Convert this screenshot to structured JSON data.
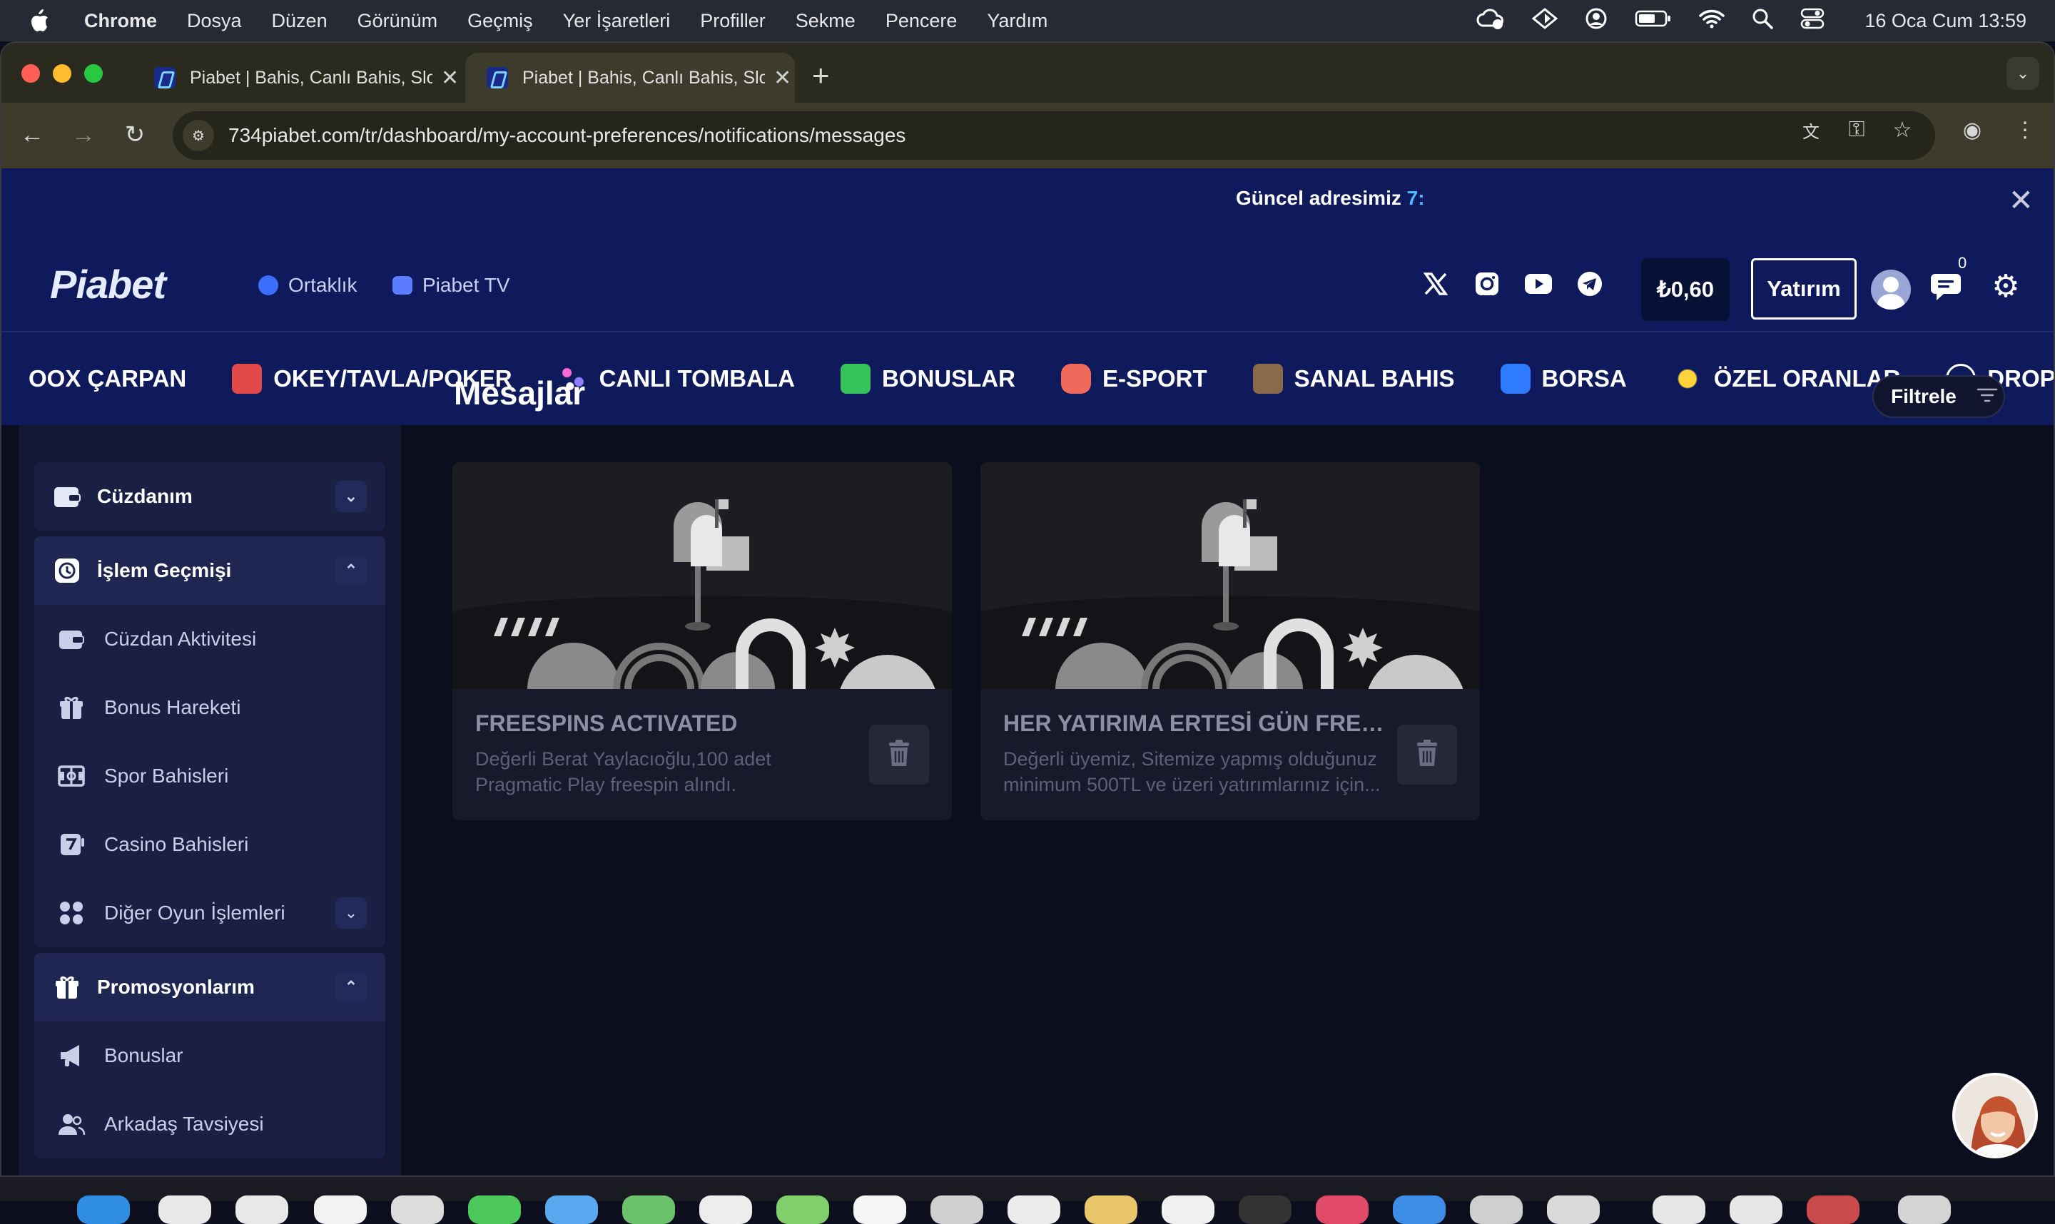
{
  "menubar": {
    "app": "Chrome",
    "items": [
      "Dosya",
      "Düzen",
      "Görünüm",
      "Geçmiş",
      "Yer İşaretleri",
      "Profiller",
      "Sekme",
      "Pencere",
      "Yardım"
    ],
    "clock": "16 Oca Cum  13:59"
  },
  "browser": {
    "tabs": [
      {
        "title": "Piabet | Bahis, Canlı Bahis, Slot"
      },
      {
        "title": "Piabet | Bahis, Canlı Bahis, Slot"
      }
    ],
    "url": "734piabet.com/tr/dashboard/my-account-preferences/notifications/messages"
  },
  "site": {
    "announcement": {
      "text": "Güncel adresimiz ",
      "highlight": "7:"
    },
    "logo": "Piabet",
    "header_links": [
      "Ortaklık",
      "Piabet TV"
    ],
    "balance": "₺0,60",
    "deposit_label": "Yatırım",
    "message_count": "0",
    "categories": [
      "OOX ÇARPAN",
      "OKEY/TAVLA/POKER",
      "CANLI TOMBALA",
      "BONUSLAR",
      "E-SPORT",
      "SANAL BAHIS",
      "BORSA",
      "ÖZEL ORANLAR",
      "DROPS & WINS"
    ]
  },
  "sidebar": {
    "wallet": {
      "label": "Cüzdanım"
    },
    "history": {
      "label": "İşlem Geçmişi",
      "items": [
        "Cüzdan Aktivitesi",
        "Bonus Hareketi",
        "Spor Bahisleri",
        "Casino Bahisleri",
        "Diğer Oyun İşlemleri"
      ]
    },
    "promotions": {
      "label": "Promosyonlarım",
      "items": [
        "Bonuslar",
        "Arkadaş Tavsiyesi"
      ]
    }
  },
  "main": {
    "title": "Mesajlar",
    "filter_label": "Filtrele",
    "messages": [
      {
        "title": "FREESPINS ACTIVATED",
        "desc": "Değerli Berat Yaylacıoğlu,100 adet Pragmatic Play freespin alındı. Kullanılacak..."
      },
      {
        "title": "HER YATIRIMA ERTESİ GÜN FREESPİN",
        "desc": "Değerli üyemiz, Sitemize yapmış olduğunuz minimum 500TL ve üzeri yatırımlarınız için..."
      }
    ]
  }
}
